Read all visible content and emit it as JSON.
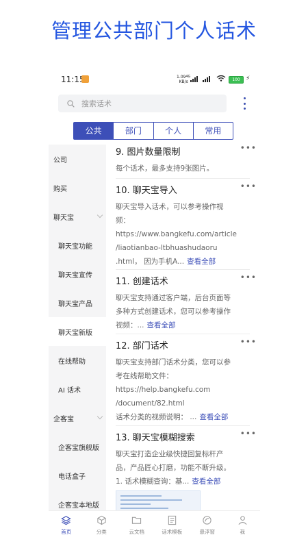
{
  "headline": "管理公共部门个人话术",
  "status_bar": {
    "time": "11:15",
    "net_speed": "1.09",
    "net_unit": "KB/s",
    "net_type": "4G",
    "battery": "100"
  },
  "search": {
    "placeholder": "搜索话术"
  },
  "tabs": [
    {
      "label": "公共",
      "active": true
    },
    {
      "label": "部门"
    },
    {
      "label": "个人"
    },
    {
      "label": "常用"
    }
  ],
  "sidebar": {
    "items": [
      {
        "label": "公司"
      },
      {
        "label": "购买"
      },
      {
        "label": "聊天宝",
        "expandable": true
      },
      {
        "label": "聊天宝功能"
      },
      {
        "label": "聊天宝宣传"
      },
      {
        "label": "聊天宝产品"
      },
      {
        "label": "聊天宝新版",
        "active": true
      },
      {
        "label": "在线帮助"
      },
      {
        "label": "AI 话术"
      },
      {
        "label": "企客宝",
        "expandable": true
      },
      {
        "label": "企客宝旗舰版"
      },
      {
        "label": "电话盒子"
      },
      {
        "label": "企客宝本地版"
      }
    ]
  },
  "scripts": [
    {
      "title": "9. 图片数量限制",
      "lines": [
        "每个话术，最多支持9张图片。"
      ]
    },
    {
      "title": "10. 聊天宝导入",
      "lines": [
        "聊天宝导入话术，可以参考操作视",
        "频：",
        "https://www.bangkefu.com/article",
        "/liaotianbao-ltbhuashudaoru",
        ".html， 因为手机A..."
      ],
      "view_all": "查看全部"
    },
    {
      "title": "11. 创建话术",
      "lines": [
        "聊天宝支持通过客户端，后台页面等",
        "多种方式创建话术，您可以参考操作",
        "视频：..."
      ],
      "view_all": "查看全部"
    },
    {
      "title": "12. 部门话术",
      "lines": [
        "聊天宝支持部门话术分类，您可以参",
        "考在线帮助文件：",
        "https://help.bangkefu.com",
        "/document/82.html",
        "话术分类的视频说明： ..."
      ],
      "view_all": "查看全部"
    },
    {
      "title": "13. 聊天宝模糊搜索",
      "lines": [
        "聊天宝打造企业级快捷回复标杆产",
        "品，产品匠心打磨，功能不断升级。",
        "1. 话术模糊查询：基..."
      ],
      "view_all": "查看全部"
    }
  ],
  "more_label": "•••",
  "bottom_nav": [
    {
      "label": "首页",
      "icon": "layers-icon",
      "active": true
    },
    {
      "label": "分类",
      "icon": "cube-icon"
    },
    {
      "label": "云文档",
      "icon": "folder-icon"
    },
    {
      "label": "话术模板",
      "icon": "template-icon"
    },
    {
      "label": "悬浮窗",
      "icon": "float-window-icon"
    },
    {
      "label": "我",
      "icon": "person-icon"
    }
  ],
  "colors": {
    "accent": "#3d4fb8",
    "headline": "#2456e0"
  }
}
